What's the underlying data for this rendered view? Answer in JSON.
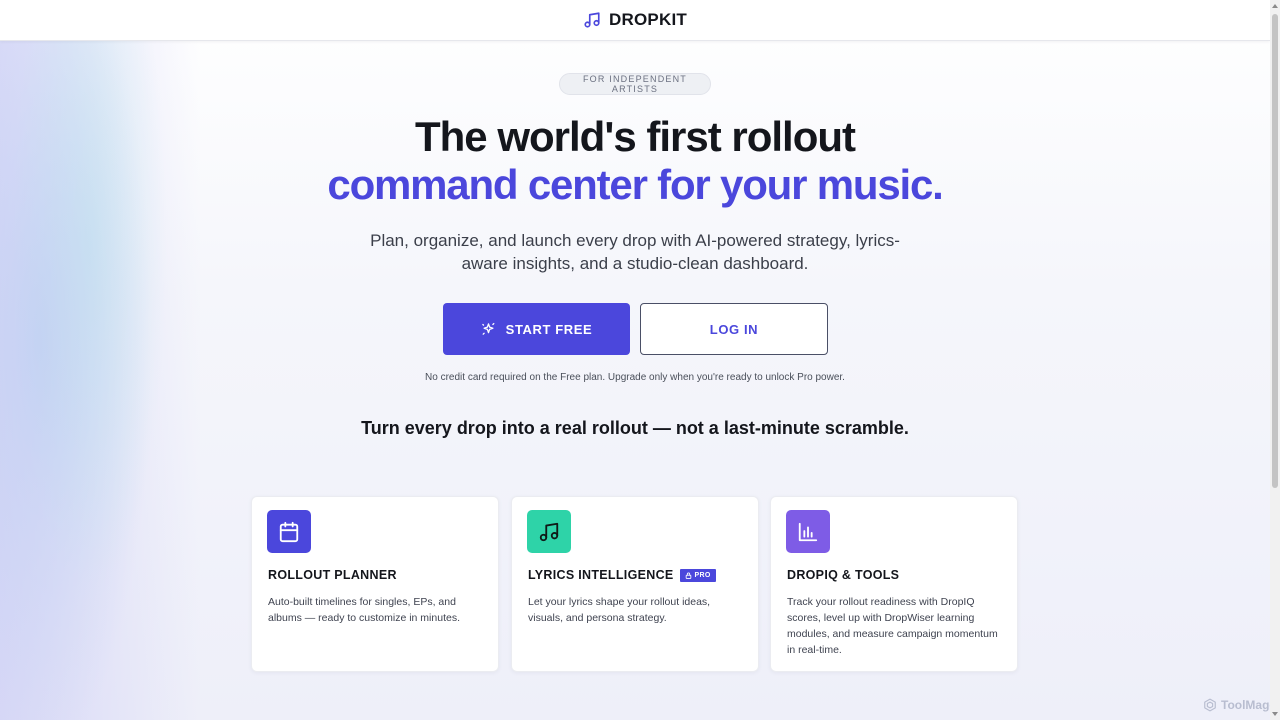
{
  "brand": {
    "name": "DROPKIT",
    "icon": "music-note-icon",
    "accent_color": "#4b47dc"
  },
  "hero": {
    "eyebrow": "FOR INDEPENDENT ARTISTS",
    "title_line1": "The world's first rollout",
    "title_line2": "command center for your music.",
    "subtitle": "Plan, organize, and launch every drop with AI-powered strategy, lyrics-aware insights, and a studio-clean dashboard.",
    "primary_cta": {
      "label": "START FREE",
      "icon": "sparkle-icon"
    },
    "secondary_cta": {
      "label": "LOG IN"
    },
    "fineprint": "No credit card required on the Free plan. Upgrade only when you're ready to unlock Pro power.",
    "tagline": "Turn every drop into a real rollout — not a last-minute scramble."
  },
  "features": [
    {
      "icon": "calendar-icon",
      "icon_color": "#4b47dc",
      "title": "ROLLOUT PLANNER",
      "body": "Auto-built timelines for singles, EPs, and albums — ready to customize in minutes."
    },
    {
      "icon": "music-note-icon",
      "icon_color": "#2ed3a8",
      "title": "LYRICS INTELLIGENCE",
      "badge": "PRO",
      "body": "Let your lyrics shape your rollout ideas, visuals, and persona strategy."
    },
    {
      "icon": "bar-chart-icon",
      "icon_color": "#7e5ce6",
      "title": "DROPIQ & TOOLS",
      "body": "Track your rollout readiness with DropIQ scores, level up with DropWiser learning modules, and measure campaign momentum in real-time."
    }
  ],
  "watermark": {
    "text": "ToolMage"
  }
}
